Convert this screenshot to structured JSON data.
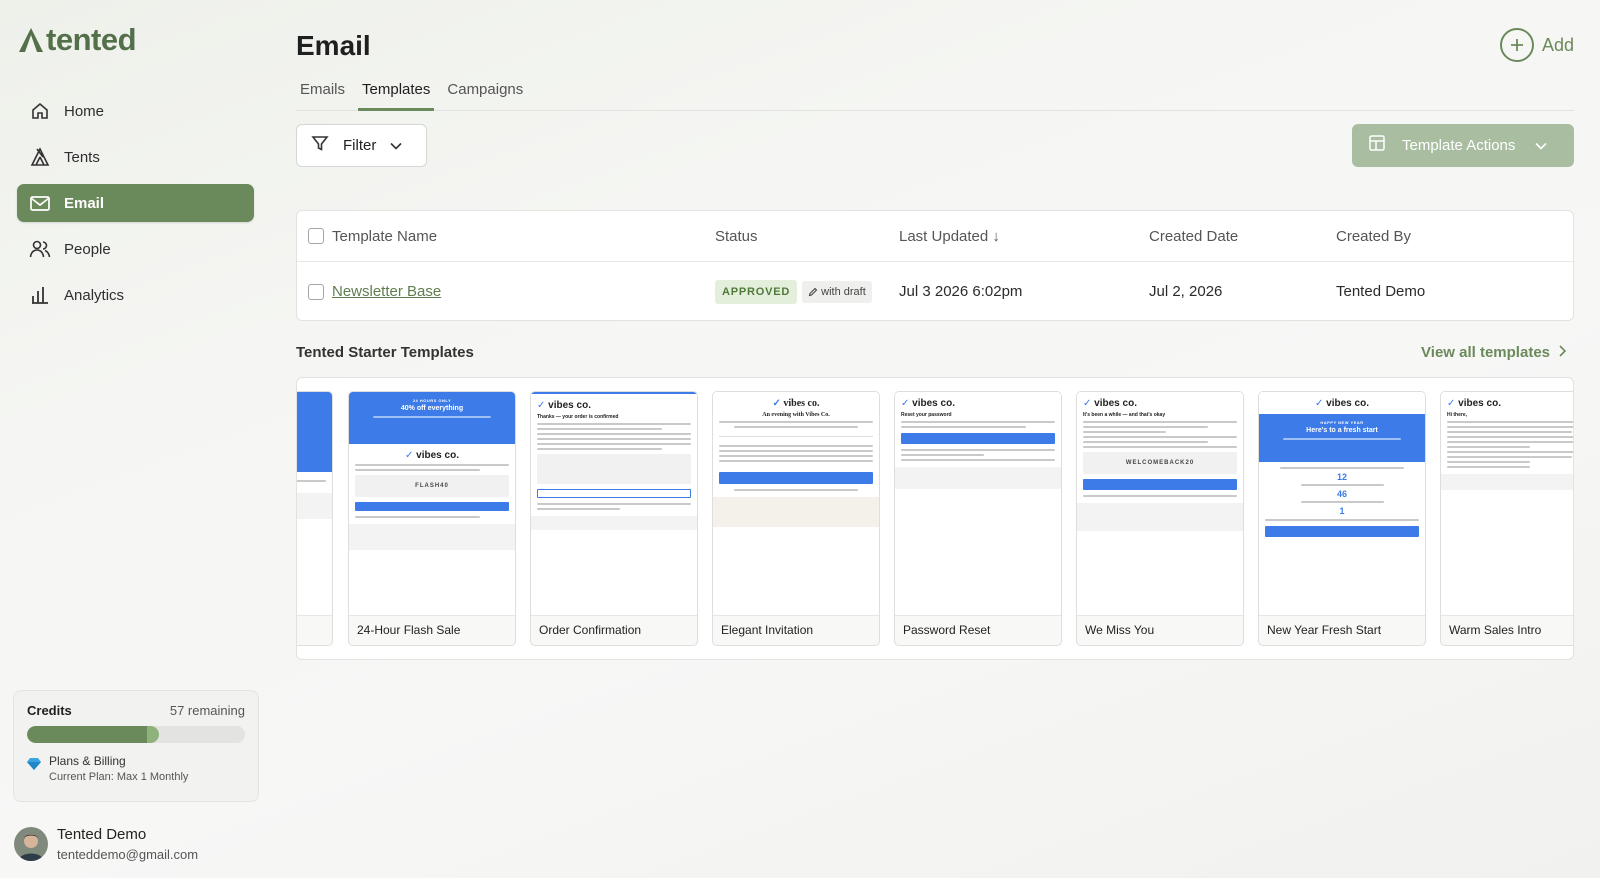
{
  "brand": {
    "name": "tented",
    "accent": "#6b8a5b"
  },
  "sidebar": {
    "items": [
      {
        "label": "Home",
        "icon": "home-icon"
      },
      {
        "label": "Tents",
        "icon": "tent-icon"
      },
      {
        "label": "Email",
        "icon": "mail-icon",
        "active": true
      },
      {
        "label": "People",
        "icon": "people-icon"
      },
      {
        "label": "Analytics",
        "icon": "analytics-icon"
      }
    ],
    "credits": {
      "title": "Credits",
      "remaining": "57 remaining",
      "used_fraction": 0.56
    },
    "plan": {
      "title": "Plans & Billing",
      "subtitle": "Current Plan: Max 1 Monthly"
    },
    "user": {
      "name": "Tented Demo",
      "email": "tenteddemo@gmail.com"
    }
  },
  "header": {
    "title": "Email",
    "add_label": "Add"
  },
  "tabs": [
    {
      "label": "Emails"
    },
    {
      "label": "Templates",
      "active": true
    },
    {
      "label": "Campaigns"
    }
  ],
  "toolbar": {
    "filter_label": "Filter",
    "actions_label": "Template Actions"
  },
  "table": {
    "columns": [
      "Template Name",
      "Status",
      "Last Updated ↓",
      "Created Date",
      "Created By"
    ],
    "rows": [
      {
        "name": "Newsletter Base",
        "status": "APPROVED",
        "draft": "with draft",
        "last_updated": "Jul 3 2026 6:02pm",
        "created_date": "Jul 2, 2026",
        "created_by": "Tented Demo"
      }
    ]
  },
  "starter": {
    "title": "Tented Starter Templates",
    "view_all": "View all templates",
    "cards": [
      {
        "label": "24-Hour Flash Sale",
        "hero_tag": "24 HOURS ONLY",
        "hero_title": "40% off everything",
        "code": "FLASH40"
      },
      {
        "label": "Order Confirmation",
        "heading": "Thanks — your order is confirmed"
      },
      {
        "label": "Elegant Invitation",
        "heading": "An evening with Vibes Co."
      },
      {
        "label": "Password Reset",
        "heading": "Reset your password"
      },
      {
        "label": "We Miss You",
        "heading": "It's been a while — and that's okay",
        "code": "WELCOMEBACK20"
      },
      {
        "label": "New Year Fresh Start",
        "hero_tag": "HAPPY NEW YEAR",
        "hero_title": "Here's to a fresh start",
        "n1": "12",
        "n2": "46",
        "n3": "1"
      },
      {
        "label": "Warm Sales Intro",
        "heading": "Hi there,"
      }
    ],
    "logo_text": "vibes co."
  }
}
